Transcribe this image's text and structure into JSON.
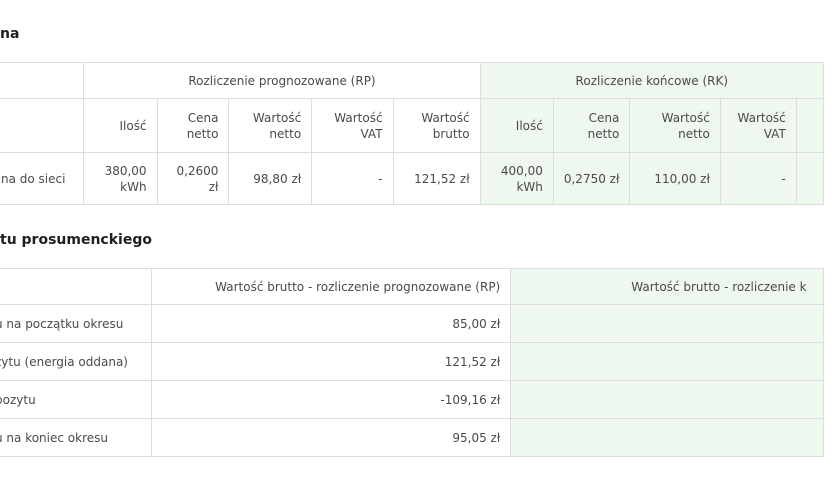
{
  "sections": {
    "top_title": "na",
    "bottom_title": "tu prosumenckiego"
  },
  "table1": {
    "group_rp": "Rozliczenie prognozowane (RP)",
    "group_rk": "Rozliczenie końcowe (RK)",
    "headers": {
      "ilosc": "Ilość",
      "cena_netto": "Cena netto",
      "wartosc_netto": "Wartość netto",
      "wartosc_vat": "Wartość VAT",
      "wartosc_brutto": "Wartość brutto"
    },
    "row": {
      "label": "na do sieci",
      "rp_ilosc": "380,00 kWh",
      "rp_cena": "0,2600 zł",
      "rp_netto": "98,80 zł",
      "rp_vat": "-",
      "rp_brutto": "121,52 zł",
      "rk_ilosc": "400,00 kWh",
      "rk_cena": "0,2750 zł",
      "rk_netto": "110,00 zł",
      "rk_vat": "-"
    }
  },
  "table2": {
    "header_rp": "Wartość brutto - rozliczenie prognozowane (RP)",
    "header_rk": "Wartość brutto - rozliczenie k",
    "rows": [
      {
        "label": "u na początku okresu",
        "value": "85,00 zł"
      },
      {
        "label": "zytu (energia oddana)",
        "value": "121,52 zł"
      },
      {
        "label": "pozytu",
        "value": "-109,16 zł"
      },
      {
        "label": "u na koniec okresu",
        "value": "95,05 zł"
      }
    ]
  },
  "colors": {
    "green_column": "#eef8ef",
    "border": "#dcdcdc"
  }
}
